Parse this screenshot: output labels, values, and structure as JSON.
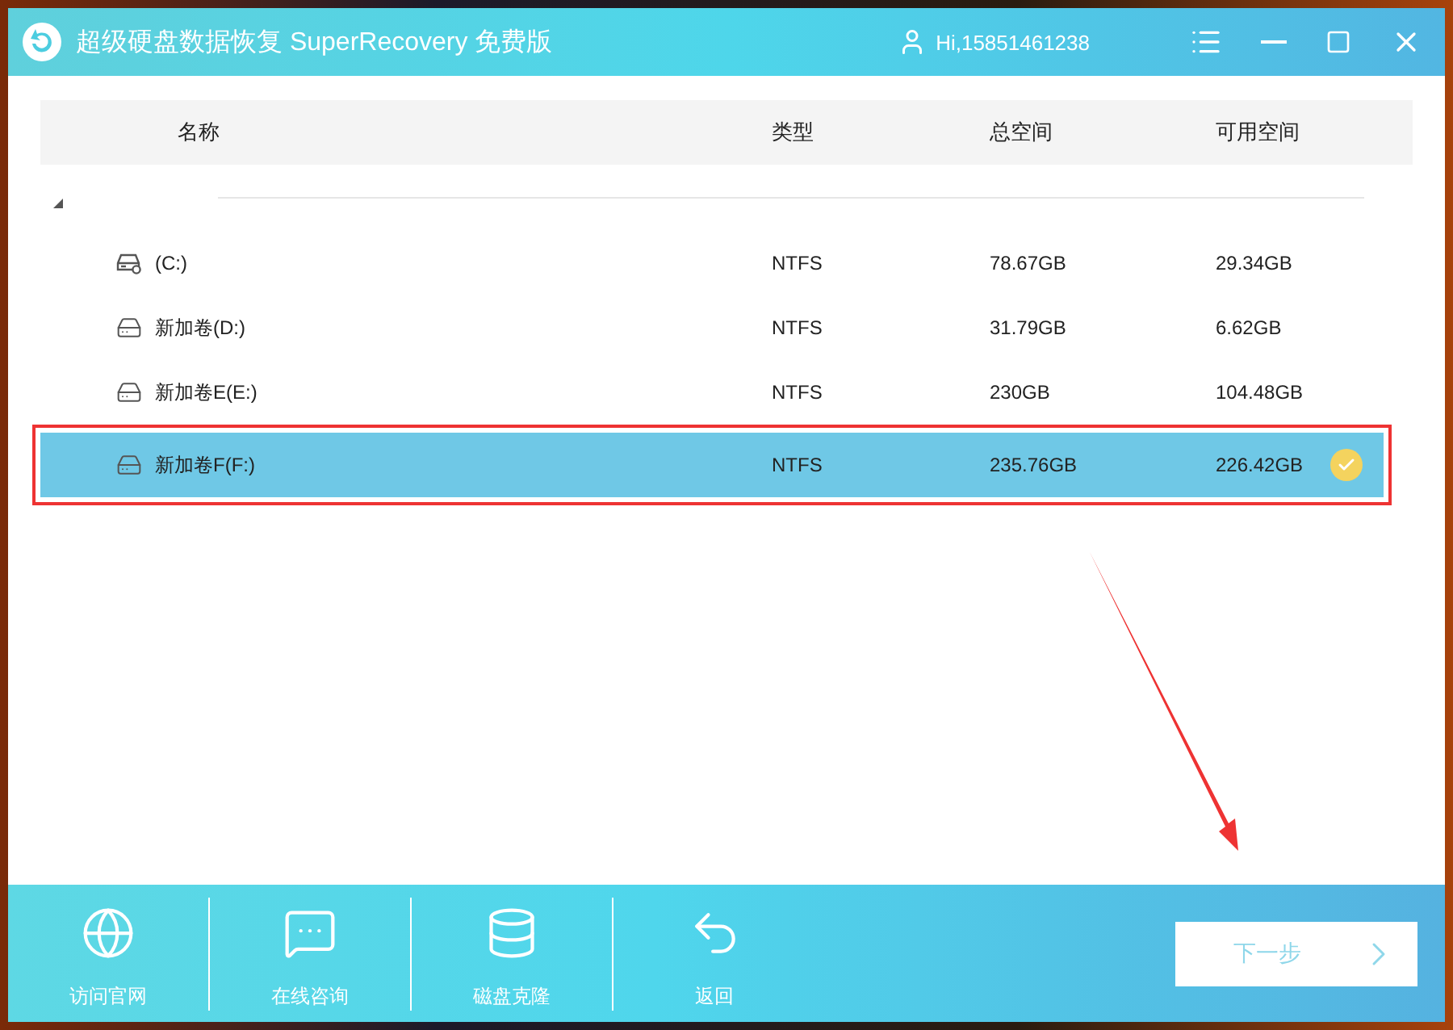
{
  "window": {
    "title": "超级硬盘数据恢复 SuperRecovery 免费版",
    "user": "Hi,15851461238"
  },
  "table": {
    "columns": [
      "名称",
      "类型",
      "总空间",
      "可用空间"
    ],
    "tree": {
      "expanded": true,
      "children": [
        {
          "kind": "system",
          "name": "(C:)",
          "type": "NTFS",
          "total": "78.67GB",
          "free": "29.34GB",
          "selected": false
        },
        {
          "kind": "volume",
          "name": "新加卷(D:)",
          "type": "NTFS",
          "total": "31.79GB",
          "free": "6.62GB",
          "selected": false
        },
        {
          "kind": "volume",
          "name": "新加卷E(E:)",
          "type": "NTFS",
          "total": "230GB",
          "free": "104.48GB",
          "selected": false
        },
        {
          "kind": "volume",
          "name": "新加卷F(F:)",
          "type": "NTFS",
          "total": "235.76GB",
          "free": "226.42GB",
          "selected": true
        }
      ]
    }
  },
  "footer": {
    "tools": [
      {
        "kind": "globe",
        "label": "访问官网"
      },
      {
        "kind": "chat",
        "label": "在线咨询"
      },
      {
        "kind": "clone",
        "label": "磁盘克隆"
      },
      {
        "kind": "back",
        "label": "返回"
      }
    ],
    "next": {
      "label": "下一步",
      "disabled": true
    }
  }
}
